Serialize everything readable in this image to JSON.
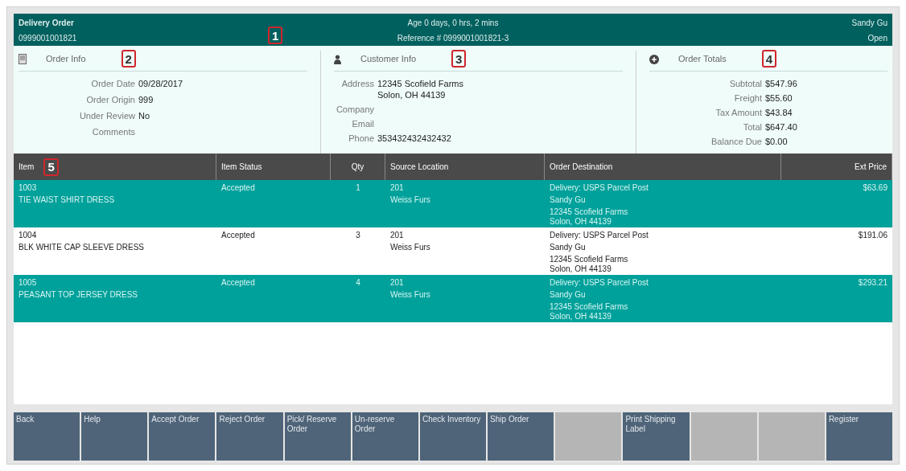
{
  "header": {
    "title": "Delivery Order",
    "order_number": "0999001001821",
    "age": "Age 0 days, 0 hrs, 2 mins",
    "reference": "Reference # 0999001001821-3",
    "customer": "Sandy Gu",
    "status": "Open",
    "marker": "1"
  },
  "order_info": {
    "title": "Order Info",
    "marker": "2",
    "fields": [
      {
        "label": "Order Date",
        "value": "09/28/2017"
      },
      {
        "label": "Order Origin",
        "value": "999"
      },
      {
        "label": "Under Review",
        "value": "No"
      },
      {
        "label": "Comments"
      }
    ]
  },
  "customer_info": {
    "title": "Customer Info",
    "marker": "3",
    "fields": [
      {
        "label": "Address",
        "value": [
          "12345 Scofield Farms",
          "Solon, OH 44139"
        ]
      },
      {
        "label": "Company"
      },
      {
        "label": "Email"
      },
      {
        "label": "Phone",
        "value": [
          "353432432432432"
        ]
      }
    ]
  },
  "order_totals": {
    "title": "Order Totals",
    "marker": "4",
    "fields": [
      {
        "label": "Subtotal",
        "value": "$547.96"
      },
      {
        "label": "Freight",
        "value": "$55.60"
      },
      {
        "label": "Tax Amount",
        "value": "$43.84"
      },
      {
        "label": "Total",
        "value": "$647.40"
      },
      {
        "label": "Balance Due",
        "value": "$0.00"
      }
    ]
  },
  "table": {
    "columns": [
      "Item",
      "Item Status",
      "Qty",
      "Source Location",
      "Order Destination",
      "Ext Price"
    ],
    "marker": "5",
    "rows": [
      {
        "selected": true,
        "item": "1003",
        "description": "TIE WAIST SHIRT DRESS",
        "status": "Accepted",
        "qty": "1",
        "source": [
          "201",
          "Weiss Furs"
        ],
        "destination": [
          "Delivery: USPS Parcel Post",
          "Sandy Gu",
          "12345 Scofield Farms",
          "Solon, OH 44139"
        ],
        "price": "$63.69"
      },
      {
        "selected": false,
        "item": "1004",
        "description": "BLK WHITE CAP SLEEVE DRESS",
        "status": "Accepted",
        "qty": "3",
        "source": [
          "201",
          "Weiss Furs"
        ],
        "destination": [
          "Delivery: USPS Parcel Post",
          "Sandy Gu",
          "12345 Scofield Farms",
          "Solon, OH 44139"
        ],
        "price": "$191.06"
      },
      {
        "selected": true,
        "item": "1005",
        "description": "PEASANT TOP JERSEY DRESS",
        "status": "Accepted",
        "qty": "4",
        "source": [
          "201",
          "Weiss Furs"
        ],
        "destination": [
          "Delivery: USPS Parcel Post",
          "Sandy Gu",
          "12345 Scofield Farms",
          "Solon, OH 44139"
        ],
        "price": "$293.21"
      }
    ]
  },
  "buttons": [
    {
      "label": "Back",
      "disabled": false
    },
    {
      "label": "Help",
      "disabled": false
    },
    {
      "label": "Accept Order",
      "disabled": false
    },
    {
      "label": "Reject Order",
      "disabled": false
    },
    {
      "label": "Pick/ Reserve Order",
      "disabled": false
    },
    {
      "label": "Un-reserve Order",
      "disabled": false
    },
    {
      "label": "Check Inventory",
      "disabled": false
    },
    {
      "label": "Ship Order",
      "disabled": false
    },
    {
      "disabled": true
    },
    {
      "label": "Print Shipping Label",
      "disabled": false
    },
    {
      "disabled": true
    },
    {
      "disabled": true
    },
    {
      "label": "Register",
      "disabled": false
    }
  ]
}
